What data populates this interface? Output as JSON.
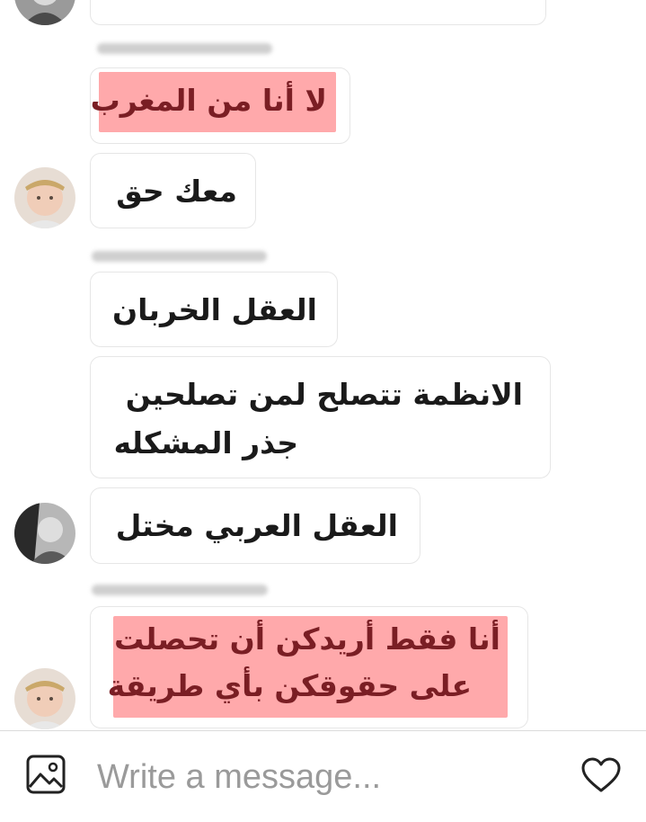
{
  "thread": {
    "messages": [
      {
        "text": "لا أنا من المغرب",
        "highlighted": true
      },
      {
        "text": "معك حق",
        "highlighted": false
      },
      {
        "text": "العقل الخربان",
        "highlighted": false
      },
      {
        "lines": [
          "الانظمة تتصلح لمن تصلحين",
          "جذر المشكله"
        ],
        "highlighted": false
      },
      {
        "text": "العقل العربي مختل",
        "highlighted": false
      },
      {
        "lines": [
          "أنا فقط أريدكن أن تحصلت",
          "على حقوقكن بأي طريقة"
        ],
        "highlighted": true
      }
    ]
  },
  "composer": {
    "placeholder": "Write a message...",
    "media_icon": "image-icon",
    "like_icon": "heart-icon"
  },
  "colors": {
    "highlight": "#ffa9ab",
    "highlight_text": "#7a1e24",
    "bubble_border": "#e6e6e6",
    "placeholder": "#9a9a9a"
  }
}
